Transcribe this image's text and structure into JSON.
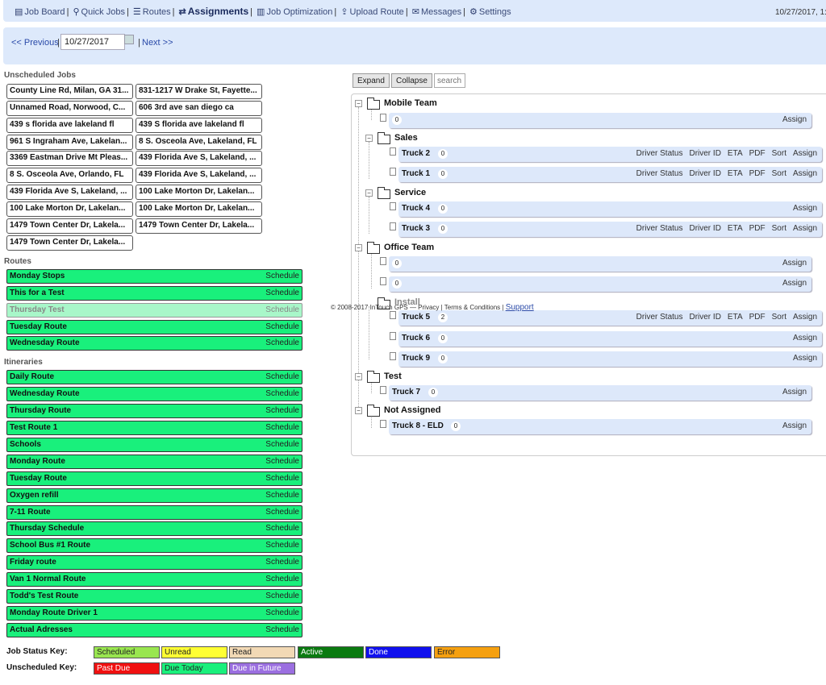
{
  "nav": {
    "items": [
      {
        "label": "Job Board",
        "icon": "board-icon",
        "active": false
      },
      {
        "label": "Quick Jobs",
        "icon": "pin-icon",
        "active": false
      },
      {
        "label": "Routes",
        "icon": "list-icon",
        "active": false
      },
      {
        "label": "Assignments",
        "icon": "swap-icon",
        "active": true
      },
      {
        "label": "Job Optimization",
        "icon": "map-icon",
        "active": false
      },
      {
        "label": "Upload Route",
        "icon": "upload-icon",
        "active": false
      },
      {
        "label": "Messages",
        "icon": "chat-icon",
        "active": false
      },
      {
        "label": "Settings",
        "icon": "gear-icon",
        "active": false
      }
    ],
    "timestamp": "10/27/2017, 1:"
  },
  "datebar": {
    "prev": "<< Previous",
    "date": "10/27/2017",
    "next": "Next >>"
  },
  "unscheduled": {
    "title": "Unscheduled Jobs",
    "jobs": [
      "County Line Rd, Milan, GA 31...",
      "831-1217 W Drake St, Fayette...",
      "Unnamed Road, Norwood, C...",
      "606 3rd ave san diego ca",
      "439 s florida ave lakeland fl",
      "439 S florida ave lakeland fl",
      "961 S Ingraham Ave, Lakelan...",
      "8 S. Osceola Ave, Lakeland, FL",
      "3369 Eastman Drive Mt Pleas...",
      "439 Florida Ave S, Lakeland, ...",
      "8 S. Osceola Ave, Orlando, FL",
      "439 Florida Ave S, Lakeland, ...",
      "439 Florida Ave S, Lakeland, ...",
      "100 Lake Morton Dr, Lakelan...",
      "100 Lake Morton Dr, Lakelan...",
      "100 Lake Morton Dr, Lakelan...",
      "1479 Town Center Dr, Lakela...",
      "1479 Town Center Dr, Lakela...",
      "1479 Town Center Dr, Lakela..."
    ]
  },
  "routes": {
    "title": "Routes",
    "items": [
      "Monday Stops",
      "This for a Test",
      "Thursday Test",
      "Tuesday Route",
      "Wednesday Route"
    ]
  },
  "itineraries": {
    "title": "Itineraries",
    "items": [
      "Daily Route",
      "Wednesday Route",
      "Thursday Route",
      "Test Route 1",
      "Schools",
      "Monday Route",
      "Tuesday Route",
      "Oxygen refill",
      "7-11 Route",
      "Thursday Schedule",
      "School Bus #1 Route",
      "Friday route",
      "Van 1 Normal Route",
      "Todd's Test Route",
      "Monday Route Driver 1",
      "Actual Adresses"
    ]
  },
  "schedule_label": "Schedule",
  "toolbar": {
    "expand": "Expand",
    "collapse": "Collapse",
    "search_placeholder": "search"
  },
  "tree": {
    "groups": [
      "Mobile Team",
      "Sales",
      "Service",
      "Office Team",
      "Install",
      "Test",
      "Not Assigned"
    ],
    "rows": [
      {
        "name": "",
        "count": "0",
        "full": false
      },
      {
        "name": "Truck 2",
        "count": "0",
        "full": true
      },
      {
        "name": "Truck 1",
        "count": "0",
        "full": true
      },
      {
        "name": "Truck 4",
        "count": "0",
        "full": false
      },
      {
        "name": "Truck 3",
        "count": "0",
        "full": true
      },
      {
        "name": "",
        "count": "0",
        "full": false
      },
      {
        "name": "",
        "count": "0",
        "full": false
      },
      {
        "name": "Truck 5",
        "count": "2",
        "full": true
      },
      {
        "name": "Truck 6",
        "count": "0",
        "full": false
      },
      {
        "name": "Truck 9",
        "count": "0",
        "full": false
      },
      {
        "name": "Truck 7",
        "count": "0",
        "full": false
      },
      {
        "name": "Truck 8 - ELD",
        "count": "0",
        "full": false
      }
    ],
    "actions": {
      "driver_status": "Driver Status",
      "driver_id": "Driver ID",
      "eta": "ETA",
      "pdf": "PDF",
      "sort": "Sort",
      "assign": "Assign"
    }
  },
  "footer": {
    "copyright": "© 2008-2017 InTouch GPS   —   Privacy | Terms & Conditions |",
    "support": "Support"
  },
  "keys": {
    "status_label": "Job Status Key:",
    "status": [
      {
        "label": "Scheduled",
        "color": "#99e64f"
      },
      {
        "label": "Unread",
        "color": "#ffff33"
      },
      {
        "label": "Read",
        "color": "#f2d9b5"
      },
      {
        "label": "Active",
        "color": "#0a7a10"
      },
      {
        "label": "Done",
        "color": "#1010ee"
      },
      {
        "label": "Error",
        "color": "#f5a010"
      }
    ],
    "unscheduled_label": "Unscheduled Key:",
    "unscheduled": [
      {
        "label": "Past Due",
        "color": "#f01010"
      },
      {
        "label": "Due Today",
        "color": "#19f07c"
      },
      {
        "label": "Due in Future",
        "color": "#9b6fe0"
      }
    ]
  }
}
